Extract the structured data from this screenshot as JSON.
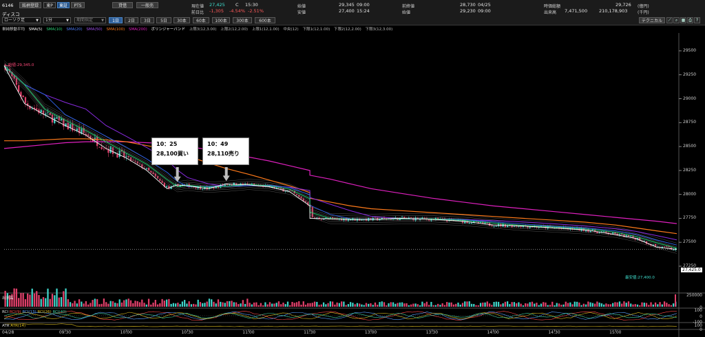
{
  "header": {
    "code": "6146",
    "name": "ディスコ",
    "buttons": {
      "watchlist": "銘柄登録",
      "market": "東P",
      "tse": "東証",
      "pts": "PTS",
      "margin": "貸借",
      "general": "一般売"
    },
    "chart_type_select": "ローソク足",
    "interval_select": "1分",
    "compare_select": "期間指定",
    "timeframes": [
      "1日",
      "2日",
      "3日",
      "5日",
      "30本",
      "60本",
      "100本",
      "300本",
      "600本"
    ],
    "selected_timeframe": "1日",
    "technical_button": "テクニカル",
    "quotes": {
      "current_label": "現在値",
      "current_value": "27,425",
      "current_mark": "C",
      "current_time": "15:30",
      "change_label": "前日比",
      "change_value": "-1,305",
      "change_pct": "-4.54%",
      "change_pct2": "-2.51%",
      "open_label": "始値",
      "open_value": "29,345",
      "open_time": "09:00",
      "low_label": "安値",
      "low_value": "27,400",
      "low_time": "15:24",
      "prev_label": "前終値",
      "prev_value": "28,730",
      "prev_date": "04/25",
      "high_label": "始値",
      "high_value": "29,230",
      "high_time": "09:00",
      "mcap_label": "時価総額",
      "mcap_value": "29,726",
      "mcap_unit": "(億円)",
      "vol_label": "出来高",
      "vol_value": "7,471,500",
      "turnover_value": "210,178,903",
      "turnover_unit": "(千円)"
    }
  },
  "legend": {
    "title": "単純移動平均",
    "sma5": "SMA(5)",
    "sma10": "SMA(10)",
    "sma20": "SMA(20)",
    "sma50": "SMA(50)",
    "sma100": "SMA(100)",
    "sma200": "SMA(200)",
    "bb": "ボリンジャーバンド",
    "bands": [
      "上限3(12,3.00)",
      "上限2(12,2.00)",
      "上限1(12,1.00)",
      "中央(12)",
      "下限1(12,1.00)",
      "下限2(12,2.00)",
      "下限3(12,3.00)"
    ]
  },
  "colors": {
    "sma5": "#ffffff",
    "sma10": "#2cd77a",
    "sma20": "#2e5fe0",
    "sma50": "#8a2be2",
    "sma100": "#ff7a1a",
    "sma200": "#e020c0",
    "up": "#3fd3c8",
    "down": "#e0406a"
  },
  "annotations": {
    "open_marker": "始値:29,345.0",
    "low_marker": "最安値:27,400.0",
    "current_price_tag": "27,425.0",
    "buy_time": "10：25",
    "buy_text": "28,100買い",
    "sell_time": "10：49",
    "sell_text": "28,110売り"
  },
  "panels": {
    "volume": "出来高",
    "rci": "RCI",
    "rci_series": [
      "RCI(9)",
      "RCI(13)",
      "RCI(26)",
      "RCI(40)"
    ],
    "atr": "ATR",
    "atr_series": "ATR(14)",
    "volume_axis": [
      "250000",
      "0"
    ],
    "rci_axis": [
      "100",
      "0",
      "-100"
    ],
    "atr_axis": [
      "100",
      "0"
    ]
  },
  "x_axis": {
    "date": "04/28",
    "times": [
      "09:30",
      "10:00",
      "10:30",
      "11:00",
      "11:30",
      "13:00",
      "13:30",
      "14:00",
      "14:30",
      "15:00"
    ]
  },
  "chart_data": {
    "type": "line",
    "title": "",
    "ylim": [
      27200,
      29600
    ],
    "yticks": [
      29500,
      29250,
      29000,
      28750,
      28500,
      28250,
      28000,
      27750,
      27500,
      27250
    ],
    "x": [
      "09:00",
      "09:10",
      "09:20",
      "09:30",
      "09:40",
      "09:50",
      "10:00",
      "10:10",
      "10:20",
      "10:25",
      "10:30",
      "10:40",
      "10:49",
      "11:00",
      "11:10",
      "11:20",
      "11:30",
      "12:30",
      "12:40",
      "12:50",
      "13:00",
      "13:15",
      "13:30",
      "13:45",
      "14:00",
      "14:15",
      "14:30",
      "14:45",
      "15:00",
      "15:10",
      "15:20",
      "15:30"
    ],
    "series": [
      {
        "name": "SMA(5)",
        "values": [
          29345,
          28950,
          28830,
          28720,
          28620,
          28480,
          28380,
          28250,
          28060,
          28100,
          28090,
          28060,
          28110,
          28100,
          28080,
          28030,
          27880,
          27750,
          27745,
          27740,
          27740,
          27750,
          27740,
          27720,
          27680,
          27670,
          27650,
          27630,
          27580,
          27540,
          27450,
          27425
        ]
      },
      {
        "name": "SMA(100)",
        "values": [
          28560,
          28560,
          28570,
          28580,
          28580,
          28570,
          28550,
          28510,
          28470,
          28440,
          28400,
          28330,
          28270,
          28210,
          28150,
          28090,
          28020,
          27960,
          27920,
          27880,
          27850,
          27830,
          27810,
          27790,
          27770,
          27750,
          27730,
          27710,
          27680,
          27650,
          27620,
          27590
        ]
      },
      {
        "name": "SMA(200)",
        "values": [
          28480,
          28500,
          28520,
          28540,
          28550,
          28550,
          28550,
          28540,
          28530,
          28520,
          28500,
          28470,
          28430,
          28390,
          28350,
          28300,
          28250,
          28200,
          28160,
          28110,
          28060,
          28010,
          27960,
          27920,
          27880,
          27850,
          27820,
          27790,
          27760,
          27740,
          27720,
          27695
        ]
      }
    ]
  }
}
